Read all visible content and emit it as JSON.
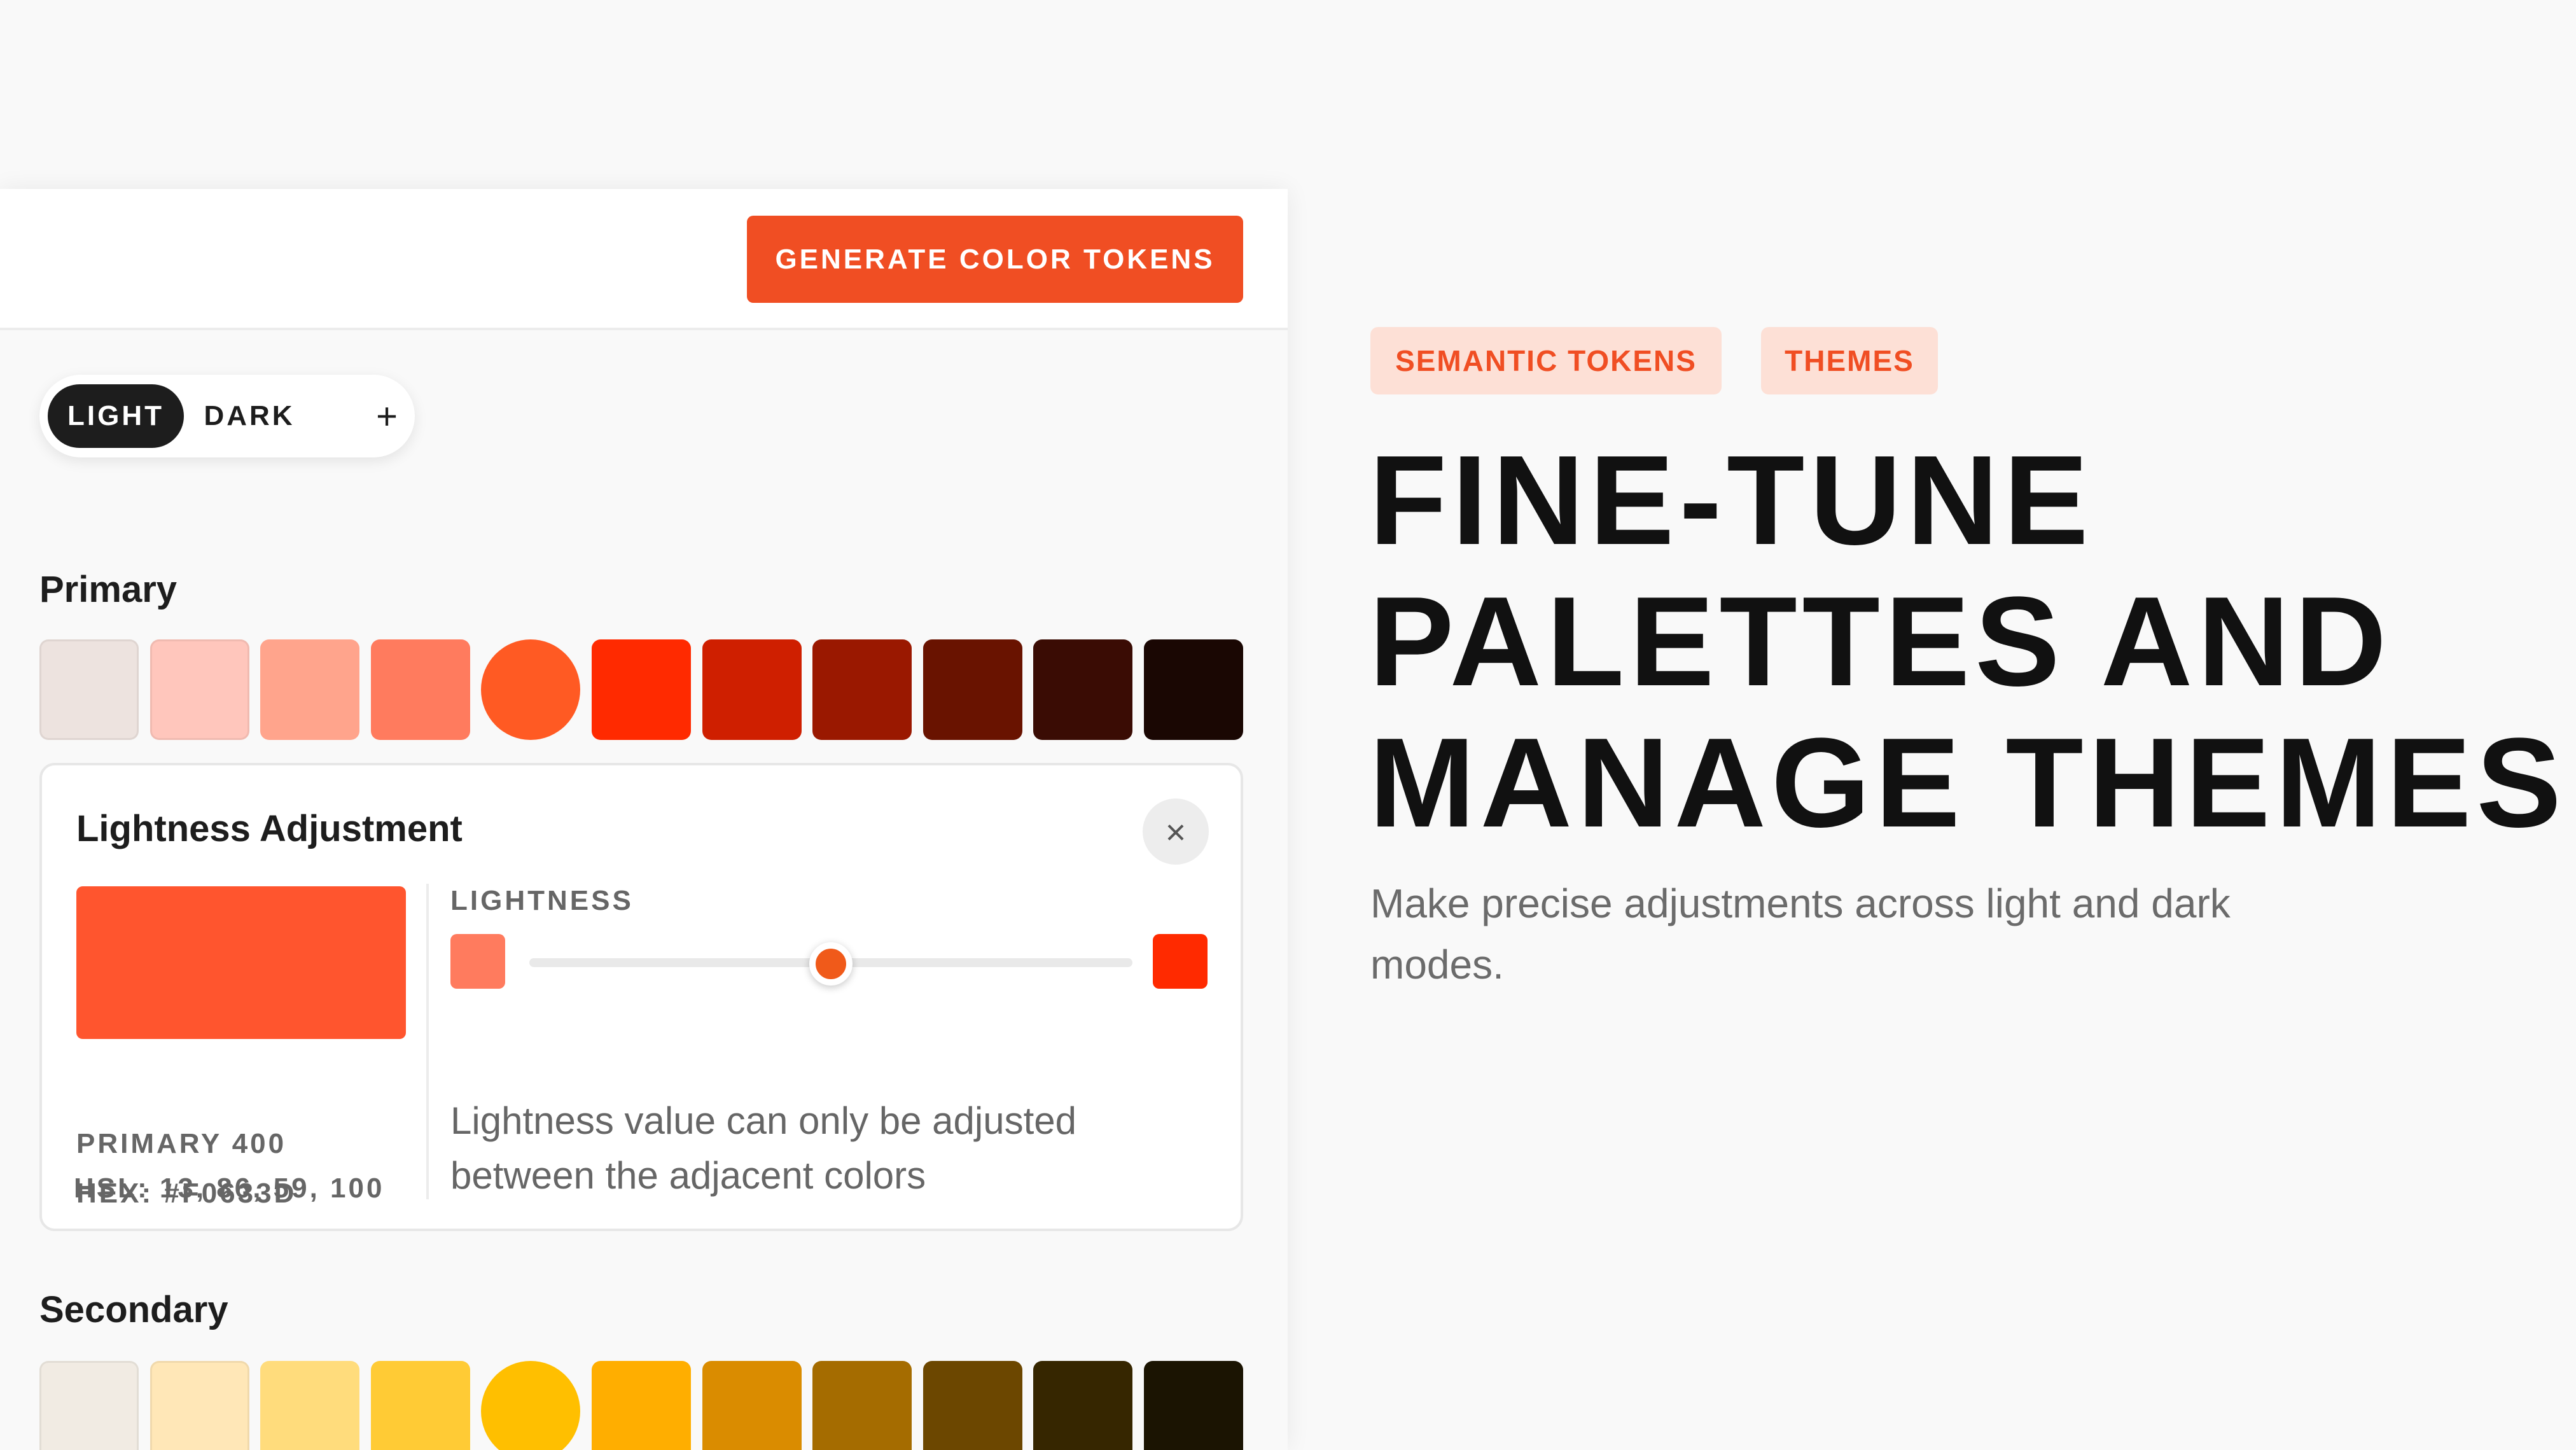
{
  "toolbar": {
    "generate_label": "GENERATE COLOR TOKENS"
  },
  "modes": {
    "light": "LIGHT",
    "dark": "DARK",
    "add": "+"
  },
  "primary": {
    "title": "Primary",
    "swatches": [
      "#ede3df",
      "#ffc6bc",
      "#ffa48c",
      "#ff7b5e",
      "#ff5a23",
      "#ff2a00",
      "#cf1f00",
      "#9a1800",
      "#691300",
      "#3a0c04",
      "#1a0703"
    ],
    "selected_index": 4
  },
  "adjust": {
    "title": "Lightness Adjustment",
    "close": "×",
    "preview_color": "#ff552e",
    "name": "PRIMARY 400",
    "hex": "HEX: #F0633D",
    "hsl": "HSL: 13, 86, 59, 100",
    "lightness_label": "LIGHTNESS",
    "left_color": "#ff7b5e",
    "right_color": "#ff2a00",
    "slider_value": 0.5,
    "hint": "Lightness value can only be adjusted between the adjacent colors"
  },
  "secondary": {
    "title": "Secondary",
    "swatches": [
      "#f1ebe3",
      "#ffe7b7",
      "#ffdc7c",
      "#ffcb35",
      "#ffbf00",
      "#ffae00",
      "#da8c00",
      "#a56c00",
      "#6c4700",
      "#362600",
      "#1b1402"
    ],
    "selected_index": 4
  },
  "marketing": {
    "tags": [
      "SEMANTIC TOKENS",
      "THEMES"
    ],
    "headline": [
      "FINE-TUNE",
      "PALETTES AND",
      "MANAGE THEMES"
    ],
    "subtext": "Make precise adjustments across light and dark modes."
  },
  "colors": {
    "accent": "#f04e23",
    "tag_bg": "#fde0d6",
    "dark": "#1d1d1d"
  }
}
